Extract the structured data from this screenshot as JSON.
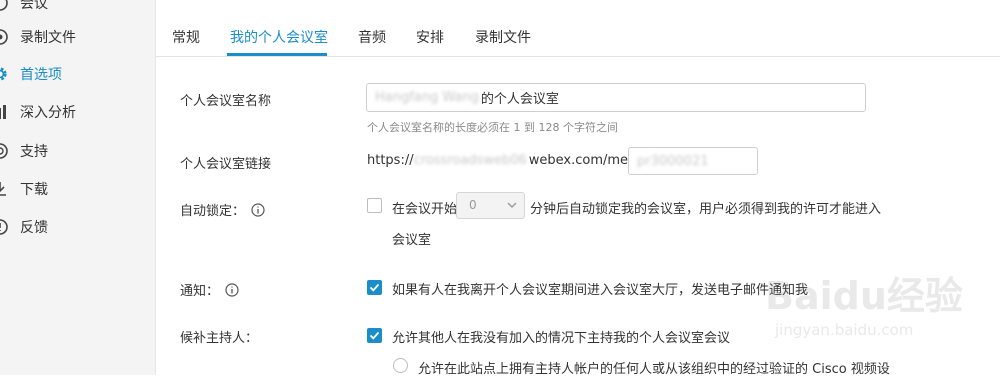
{
  "sidebar": {
    "items": [
      {
        "label": "会议",
        "icon": "meetings-icon"
      },
      {
        "label": "录制文件",
        "icon": "recordings-icon"
      },
      {
        "label": "首选项",
        "icon": "gear-icon",
        "active": true
      },
      {
        "label": "深入分析",
        "icon": "analytics-icon"
      },
      {
        "label": "支持",
        "icon": "support-icon"
      },
      {
        "label": "下载",
        "icon": "download-icon"
      },
      {
        "label": "反馈",
        "icon": "feedback-icon"
      }
    ]
  },
  "tabs": [
    {
      "label": "常规"
    },
    {
      "label": "我的个人会议室",
      "active": true
    },
    {
      "label": "音频"
    },
    {
      "label": "安排"
    },
    {
      "label": "录制文件"
    }
  ],
  "form": {
    "room_name": {
      "label": "个人会议室名称",
      "value_blurred": "Hangfang Wang",
      "value_suffix": "的个人会议室",
      "hint": "个人会议室名称的长度必须在 1 到 128 个字符之间"
    },
    "room_link": {
      "label": "个人会议室链接",
      "prefix": "https://",
      "host_blurred": "crossroadsweb06",
      "suffix": "webex.com/meet/",
      "id_blurred": "pr3000021"
    },
    "auto_lock": {
      "label": "自动锁定：",
      "text_before": "在会议开始",
      "minutes": "0",
      "text_after": "分钟后自动锁定我的会议室，用户必须得到我的许可才能进入",
      "text_wrap": "会议室",
      "checked": false
    },
    "notify": {
      "label": "通知：",
      "text": "如果有人在我离开个人会议室期间进入会议室大厅，发送电子邮件通知我",
      "checked": true
    },
    "alternate_host": {
      "label": "候补主持人：",
      "text": "允许其他人在我没有加入的情况下主持我的个人会议室会议",
      "checked": true,
      "option_text": "允许在此站点上拥有主持人帐户的任何人或从该组织中的经过验证的 Cisco 视频设"
    }
  },
  "watermark": {
    "text": "Baidu经验",
    "url": "jingyan.baidu.com"
  },
  "colors": {
    "accent": "#1b8ec7",
    "sidebar_bg": "#f4f4f4"
  }
}
